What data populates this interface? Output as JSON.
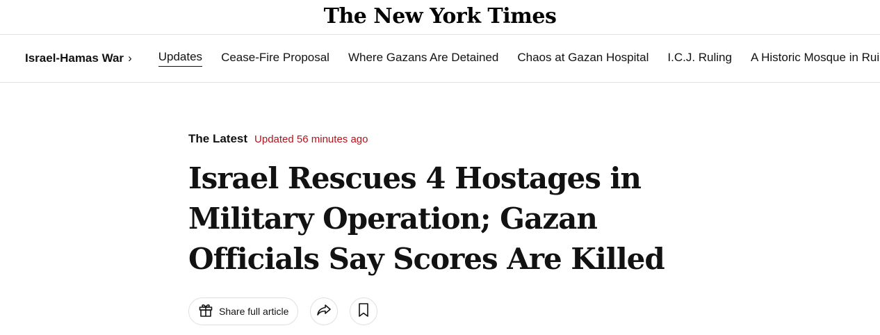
{
  "masthead": {
    "logo_text": "The New York Times"
  },
  "subnav": {
    "section_label": "Israel-Hamas War",
    "chevron": "›",
    "items": [
      {
        "label": "Updates",
        "active": true
      },
      {
        "label": "Cease-Fire Proposal",
        "active": false
      },
      {
        "label": "Where Gazans Are Detained",
        "active": false
      },
      {
        "label": "Chaos at Gazan Hospital",
        "active": false
      },
      {
        "label": "I.C.J. Ruling",
        "active": false
      },
      {
        "label": "A Historic Mosque in Ruins",
        "active": false
      }
    ]
  },
  "article": {
    "kicker": "The Latest",
    "updated": "Updated 56 minutes ago",
    "headline": "Israel Rescues 4 Hostages in Military Operation; Gazan Officials Say Scores Are Killed"
  },
  "share_tools": {
    "share_label": "Share full article",
    "icons": [
      "gift-icon",
      "share-arrow-icon",
      "bookmark-icon"
    ]
  },
  "colors": {
    "text": "#121212",
    "timestamp": "#b3121a",
    "border": "#dfdfdf"
  }
}
